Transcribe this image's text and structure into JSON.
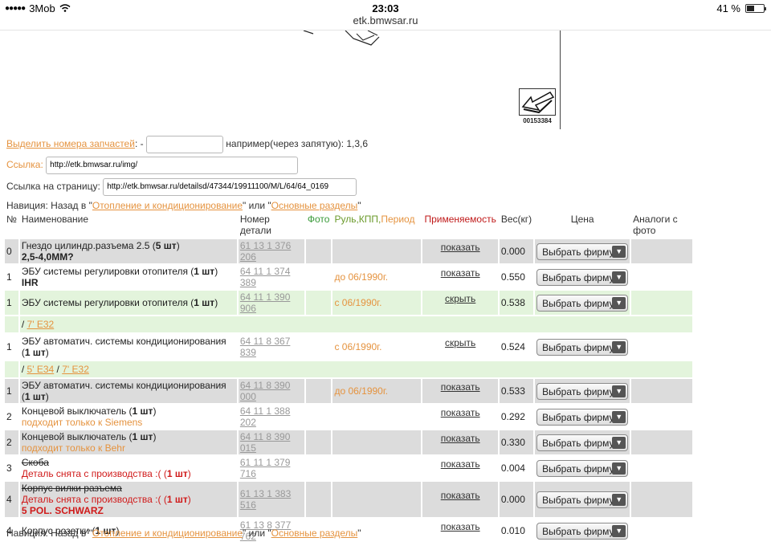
{
  "status": {
    "carrier": "3Mob",
    "time": "23:03",
    "battery": "41 %",
    "battery_level": 0.41
  },
  "browser": {
    "url": "etk.bmwsar.ru"
  },
  "diagram": {
    "image_number": "00153384"
  },
  "form": {
    "highlight_link": "Выделить номера запчастей",
    "highlight_sep": ": -",
    "highlight_example": "например(через запятую): 1,3,6",
    "link_label": "Ссылка:",
    "link_value": "http://etk.bmwsar.ru/img/",
    "page_link_label": "Ссылка на страницу:",
    "page_link_value": "http://etk.bmwsar.ru/detailsd/47344/19911100/M/L/64/64_0169"
  },
  "nav": {
    "prefix": "Навиция: Назад в \"",
    "link1": "Отопление и кондиционирование",
    "middle": "\" или \"",
    "link2": "Основные разделы",
    "suffix": "\""
  },
  "headers": {
    "num": "№",
    "name": "Наименование",
    "part": "Номер детали",
    "photo": "Фото",
    "rul": "Руль,КПП,",
    "period": "Период",
    "app": "Применяемость",
    "weight": "Вес(кг)",
    "price": "Цена",
    "analog": "Аналоги с фото"
  },
  "rows": [
    {
      "n": "0",
      "name": "Гнездо цилиндр.разъема 2.5 (",
      "qty": "5 шт",
      "close": ")",
      "extra": "2,5-4,0MM?",
      "part": "61 13 1 376 206",
      "period": "",
      "app": "показать",
      "weight": "0.000",
      "price": "Выбрать фирму"
    },
    {
      "n": "1",
      "name": "ЭБУ системы регулировки отопителя (",
      "qty": "1 шт",
      "close": ")",
      "extra": "IHR",
      "part": "64 11 1 374 389",
      "period": "до 06/1990г.",
      "app": "показать",
      "weight": "0.550",
      "price": "Выбрать фирму"
    },
    {
      "n": "1",
      "name": "ЭБУ системы регулировки отопителя (",
      "qty": "1 шт",
      "close": ")",
      "part": "64 11 1 390 906",
      "period": "с 06/1990г.",
      "app": "скрыть",
      "weight": "0.538",
      "price": "Выбрать фирму"
    },
    {
      "group": [
        "7' E32"
      ]
    },
    {
      "n": "1",
      "name": "ЭБУ автоматич. системы кондиционирования (",
      "qty": "1 шт",
      "close": ")",
      "part": "64 11 8 367 839",
      "period": "с 06/1990г.",
      "app": "скрыть",
      "weight": "0.524",
      "price": "Выбрать фирму"
    },
    {
      "group": [
        "5' E34",
        "7' E32"
      ]
    },
    {
      "n": "1",
      "name": "ЭБУ автоматич. системы кондиционирования (",
      "qty": "1 шт",
      "close": ")",
      "part": "64 11 8 390 000",
      "period": "до 06/1990г.",
      "app": "показать",
      "weight": "0.533",
      "price": "Выбрать фирму"
    },
    {
      "n": "2",
      "name": "Концевой выключатель (",
      "qty": "1 шт",
      "close": ")",
      "note": "подходит только к Siemens",
      "part": "64 11 1 388 202",
      "period": "",
      "app": "показать",
      "weight": "0.292",
      "price": "Выбрать фирму"
    },
    {
      "n": "2",
      "name": "Концевой выключатель (",
      "qty": "1 шт",
      "close": ")",
      "note": "подходит только к Behr",
      "part": "64 11 8 390 015",
      "period": "",
      "app": "показать",
      "weight": "0.330",
      "price": "Выбрать фирму"
    },
    {
      "n": "3",
      "name": "Скоба",
      "strike": true,
      "red": "Деталь снята с производства :( (",
      "qty": "1 шт",
      "close": ")",
      "part": "61 11 1 379 716",
      "period": "",
      "app": "показать",
      "weight": "0.004",
      "price": "Выбрать фирму"
    },
    {
      "n": "4",
      "name": "Корпус вилки разъема",
      "strike": true,
      "red": "Деталь снята с производства :( (",
      "qty": "1 шт",
      "close": ")",
      "redextra": "5 POL. SCHWARZ",
      "part": "61 13 1 383 516",
      "period": "",
      "app": "показать",
      "weight": "0.000",
      "price": "Выбрать фирму"
    },
    {
      "n": "4",
      "name": "Корпус розетки (",
      "qty": "1 шт",
      "close": ")",
      "part": "61 13 8 377 762",
      "period": "",
      "app": "показать",
      "weight": "0.010",
      "price": "Выбрать фирму"
    }
  ],
  "row_styles": [
    "gray",
    "white",
    "green",
    "group",
    "white",
    "group",
    "gray",
    "white",
    "gray",
    "white",
    "gray",
    "white"
  ]
}
